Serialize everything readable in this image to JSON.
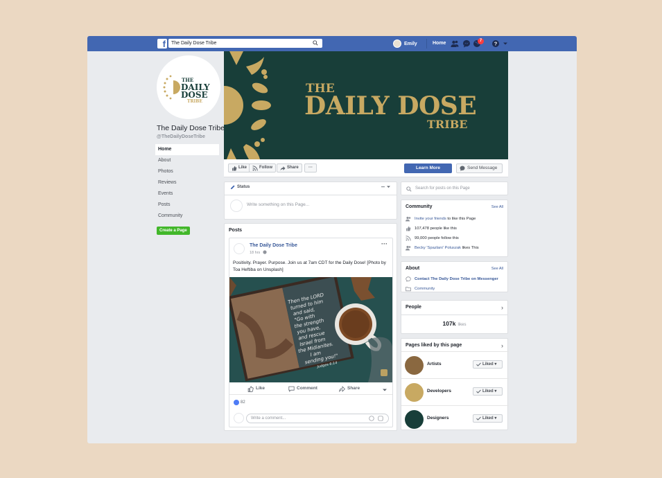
{
  "topbar": {
    "search_value": "The Daily Dose Tribe",
    "user_name": "Emily",
    "home_label": "Home",
    "notification_count": "7"
  },
  "page": {
    "name": "The Daily Dose Tribe",
    "handle": "@TheDailyDoseTribe",
    "logo_text": [
      "THE",
      "DAILY",
      "DOSE",
      "TRIBE"
    ]
  },
  "left_nav": {
    "items": [
      "Home",
      "About",
      "Photos",
      "Reviews",
      "Events",
      "Posts",
      "Community"
    ],
    "create_page_label": "Create a Page"
  },
  "cover": {
    "line1": "THE",
    "line2": "DAILY DOSE",
    "line3": "TRIBE",
    "bg_color": "#183e39",
    "accent_color": "#c8a962"
  },
  "actions": {
    "like": "Like",
    "follow": "Follow",
    "share": "Share",
    "more": "···",
    "learn_more": "Learn More",
    "send_message": "Send Message"
  },
  "composer": {
    "tab_label": "Status",
    "placeholder": "Write something on this Page..."
  },
  "posts": {
    "header": "Posts",
    "post": {
      "author": "The Daily Dose Tribe",
      "time": "18 hrs",
      "text": "Positivity. Prayer. Purpose. Join us at 7am CDT for the Daily Dose! [Photo by Toa Heftiba on Unsplash]",
      "photo_text": [
        "Then the LORD",
        "turned to him",
        "and said,",
        "\"Go with",
        "the strength",
        "you have,",
        "and rescue",
        "Israel from",
        "the Midianites.",
        "I am",
        "sending you!\"",
        "Judges 6:14"
      ],
      "actions": [
        "Like",
        "Comment",
        "Share"
      ],
      "reaction_count": "82",
      "comment_placeholder": "Write a comment..."
    }
  },
  "right": {
    "search_placeholder": "Search for posts on this Page",
    "community": {
      "title": "Community",
      "see_all": "See All",
      "invite_link": "Invite your friends",
      "invite_rest": " to like this Page",
      "likes": "107,478 people like this",
      "follows": "99,000 people follow this",
      "friend_name": "Becky 'Spazlani' Poluszak",
      "friend_rest": " likes This"
    },
    "about": {
      "title": "About",
      "see_all": "See All",
      "contact": "Contact The Daily Dose Tribe on Messenger",
      "category": "Community"
    },
    "people": {
      "title": "People",
      "count": "107k",
      "unit": "likes"
    },
    "pages_liked": {
      "title": "Pages liked by this page",
      "items": [
        {
          "name": "Artists",
          "button": "Liked",
          "color": "#8a6840"
        },
        {
          "name": "Developers",
          "button": "Liked",
          "color": "#c8a962"
        },
        {
          "name": "Designers",
          "button": "Liked",
          "color": "#183e39"
        }
      ]
    }
  }
}
